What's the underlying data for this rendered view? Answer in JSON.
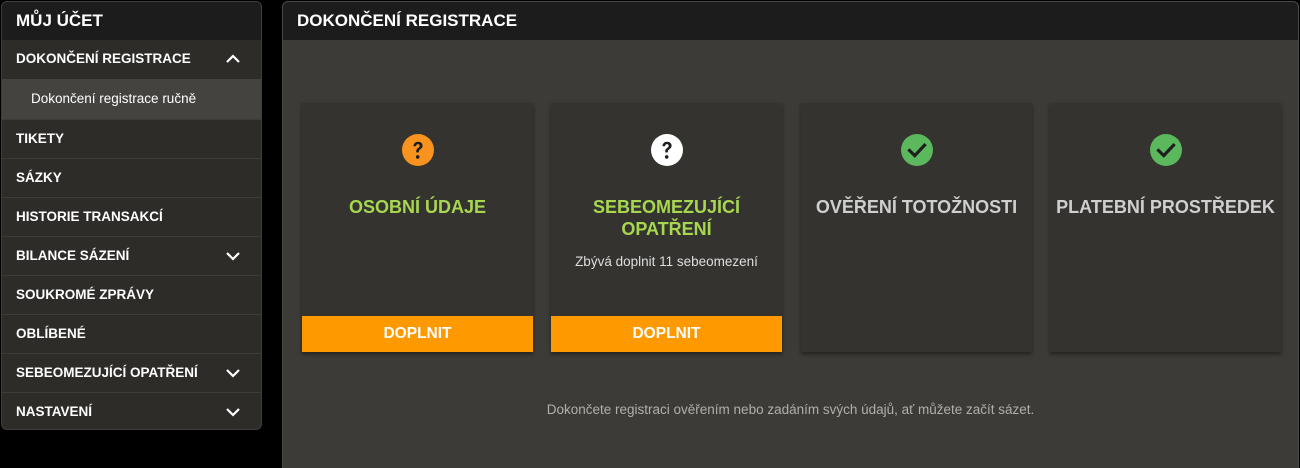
{
  "sidebar": {
    "title": "MŮJ ÚČET",
    "items": [
      {
        "label": "DOKONČENÍ REGISTRACE",
        "chevron": "chevron-up-icon"
      },
      {
        "label": "Dokončení registrace ručně"
      },
      {
        "label": "TIKETY"
      },
      {
        "label": "SÁZKY"
      },
      {
        "label": "HISTORIE TRANSAKCÍ"
      },
      {
        "label": "BILANCE SÁZENÍ",
        "chevron": "chevron-down-icon"
      },
      {
        "label": "SOUKROMÉ ZPRÁVY"
      },
      {
        "label": "OBLÍBENÉ"
      },
      {
        "label": "SEBEOMEZUJÍCÍ OPATŘENÍ",
        "chevron": "chevron-down-icon"
      },
      {
        "label": "NASTAVENÍ",
        "chevron": "chevron-down-icon"
      }
    ]
  },
  "main": {
    "title": "DOKONČENÍ REGISTRACE",
    "cards": [
      {
        "icon": "question-icon",
        "icon_color": "#f7931e",
        "title": "OSOBNÍ ÚDAJE",
        "button": "DOPLNIT"
      },
      {
        "icon": "question-icon",
        "icon_color": "#ffffff",
        "title": "SEBEOMEZUJÍCÍ OPATŘENÍ",
        "subtitle": "Zbývá doplnit 11 sebeomezení",
        "button": "DOPLNIT"
      },
      {
        "icon": "check-icon",
        "icon_color": "#5cb85c",
        "title": "OVĚŘENÍ TOTOŽNOSTI"
      },
      {
        "icon": "check-icon",
        "icon_color": "#5cb85c",
        "title": "PLATEBNÍ PROSTŘEDEK"
      }
    ],
    "note": "Dokončete registraci ověřením nebo zadáním svých údajů, ať můžete začít sázet."
  },
  "colors": {
    "accent": "#ff9900",
    "title_green": "#a6d74f",
    "check_green": "#5cb85c"
  }
}
